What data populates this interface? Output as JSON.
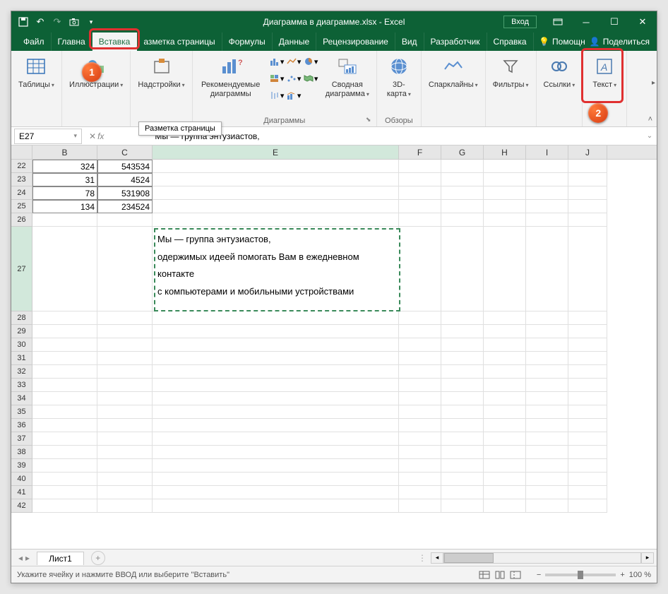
{
  "title": "Диаграмма в диаграмме.xlsx - Excel",
  "signin": "Вход",
  "menutabs": [
    "Файл",
    "Главная",
    "Вставка",
    "Разметка страницы",
    "Формулы",
    "Данные",
    "Рецензирование",
    "Вид",
    "Разработчик",
    "Справка"
  ],
  "menutabs_display": [
    "Файл",
    "Главна",
    "Вставка",
    "азметка страницы",
    "Формулы",
    "Данные",
    "Рецензирование",
    "Вид",
    "Разработчик",
    "Справка"
  ],
  "active_tab_index": 2,
  "help_label": "Помощн",
  "share_label": "Поделиться",
  "ribbon": {
    "tables": "Таблицы",
    "illustrations": "Иллюстрации",
    "addins": "Надстройки",
    "recommended_charts": "Рекомендуемые\nдиаграммы",
    "charts_group": "Диаграммы",
    "pivot_chart": "Сводная\nдиаграмма",
    "map3d": "3D-\nкарта",
    "tours_group": "Обзоры",
    "sparklines": "Спарклайны",
    "filters": "Фильтры",
    "links": "Ссылки",
    "text": "Текст"
  },
  "tooltip": "Разметка страницы",
  "namebox": "E27",
  "formula_text": "Мы — группа энтузиастов,",
  "columns": [
    "B",
    "C",
    "E",
    "F",
    "G",
    "H",
    "I",
    "J"
  ],
  "col_widths": {
    "B": 92,
    "C": 78,
    "E": 349,
    "F": 60,
    "G": 60,
    "H": 60,
    "I": 60,
    "J": 55
  },
  "rows": [
    22,
    23,
    24,
    25,
    26,
    27,
    28,
    29,
    30,
    31,
    32,
    33,
    34,
    35,
    36,
    37,
    38,
    39,
    40,
    41,
    42
  ],
  "data": {
    "22": {
      "B": "324",
      "C": "543534"
    },
    "23": {
      "B": "31",
      "C": "4524"
    },
    "24": {
      "B": "78",
      "C": "531908"
    },
    "25": {
      "B": "134",
      "C": "234524"
    }
  },
  "selected_row": 27,
  "selected_col": "E",
  "textbox_lines": [
    "Мы — группа энтузиастов,",
    "одержимых идеей помогать Вам в ежедневном",
    "контакте",
    "с компьютерами и мобильными устройствами"
  ],
  "sheet_name": "Лист1",
  "status_text": "Укажите ячейку и нажмите ВВОД или выберите \"Вставить\"",
  "zoom": "100 %",
  "callouts": {
    "1": "1",
    "2": "2"
  }
}
